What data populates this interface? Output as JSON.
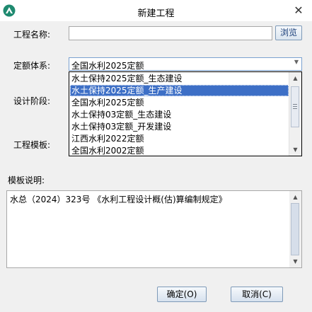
{
  "window": {
    "title": "新建工程",
    "close_glyph": "✕"
  },
  "form": {
    "project_name_label": "工程名称:",
    "project_name_value": "",
    "browse_label": "浏览",
    "quota_system_label": "定额体系:",
    "quota_system_selected": "全国水利2025定额",
    "quota_system_options": [
      "水土保持2025定额_生态建设",
      "水土保持2025定额_生产建设",
      "全国水利2025定额",
      "水土保持03定额_生态建设",
      "水土保持03定额_开发建设",
      "江西水利2022定额",
      "全国水利2002定额"
    ],
    "highlighted_option_index": 1,
    "design_stage_label": "设计阶段:",
    "template_label": "工程模板:"
  },
  "description": {
    "label": "模板说明:",
    "text": "水总（2024）323号 《水利工程设计概(估)算编制规定》"
  },
  "buttons": {
    "ok": "确定(O)",
    "cancel": "取消(C)"
  },
  "icons": {
    "app": "app-logo-icon",
    "dropdown": "dropdown-arrow-icon",
    "scroll_up": "scroll-up-icon",
    "scroll_down": "scroll-down-icon"
  },
  "colors": {
    "selection": "#3d6fc6",
    "button_border": "#7e9ab8"
  }
}
